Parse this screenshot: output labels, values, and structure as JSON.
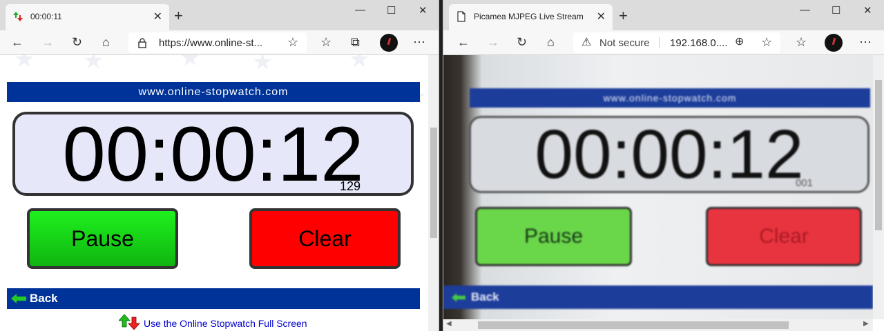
{
  "left_window": {
    "tab": {
      "title": "00:00:11",
      "favicon": "stopwatch-favicon-icon"
    },
    "url": "https://www.online-st...",
    "page": {
      "site_banner": "www.online-stopwatch.com",
      "time": "00:00:12",
      "milliseconds": "129",
      "pause_label": "Pause",
      "clear_label": "Clear",
      "back_label": "Back",
      "fullscreen_link": "Use the Online Stopwatch Full Screen"
    }
  },
  "right_window": {
    "tab": {
      "title": "Picamea MJPEG Live Stream",
      "favicon": "page-icon"
    },
    "security_label": "Not secure",
    "url": "192.168.0....",
    "stream": {
      "site_banner": "www.online-stopwatch.com",
      "time": "00:00:12",
      "milliseconds": "001",
      "pause_label": "Pause",
      "clear_label": "Clear",
      "back_label": "Back"
    }
  },
  "window_controls": {
    "minimize": "—",
    "maximize": "☐",
    "close": "✕"
  },
  "colors": {
    "banner_blue": "#003399",
    "pause_green": "#10e010",
    "clear_red": "#ff0000",
    "display_bg": "#e6e8fa"
  }
}
